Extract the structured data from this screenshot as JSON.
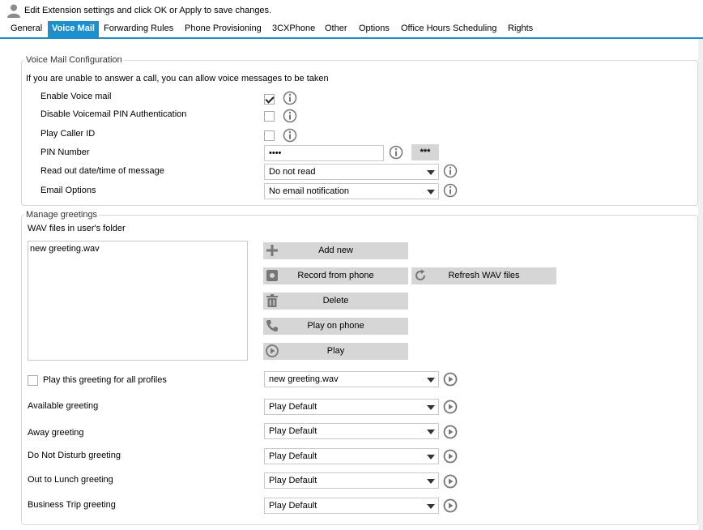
{
  "header": {
    "text": "Edit Extension settings and click OK or Apply to save changes."
  },
  "tabs": [
    {
      "label": "General"
    },
    {
      "label": "Voice Mail"
    },
    {
      "label": "Forwarding Rules"
    },
    {
      "label": "Phone Provisioning"
    },
    {
      "label": "3CXPhone"
    },
    {
      "label": "Other"
    },
    {
      "label": "Options"
    },
    {
      "label": "Office Hours Scheduling"
    },
    {
      "label": "Rights"
    }
  ],
  "active_tab": "Voice Mail",
  "voicemail": {
    "legend": "Voice Mail Configuration",
    "intro": "If you are unable to answer a call, you can allow voice messages to be taken",
    "enable_label": "Enable Voice mail",
    "enable_checked": true,
    "disable_pin_label": "Disable Voicemail PIN Authentication",
    "disable_pin_checked": false,
    "play_caller_label": "Play Caller ID",
    "play_caller_checked": false,
    "pin_label": "PIN Number",
    "pin_value": "••••",
    "pin_button": "***",
    "readout_label": "Read out date/time of message",
    "readout_value": "Do not read",
    "email_label": "Email Options",
    "email_value": "No email notification"
  },
  "greetings": {
    "legend": "Manage greetings",
    "wav_label": "WAV files in user's folder",
    "files": [
      "new greeting.wav"
    ],
    "add_new": "Add new",
    "record": "Record from phone",
    "refresh": "Refresh WAV files",
    "delete": "Delete",
    "play_on_phone": "Play on phone",
    "play": "Play",
    "all_profiles_label": "Play this greeting for all profiles",
    "all_profiles_checked": false,
    "all_profiles_value": "new greeting.wav",
    "profiles": [
      {
        "label": "Available greeting",
        "value": "Play Default"
      },
      {
        "label": "Away greeting",
        "value": "Play Default"
      },
      {
        "label": "Do Not Disturb greeting",
        "value": "Play Default"
      },
      {
        "label": "Out to Lunch greeting",
        "value": "Play Default"
      },
      {
        "label": "Business Trip greeting",
        "value": "Play Default"
      }
    ]
  },
  "colors": {
    "accent": "#1c8fcf",
    "button": "#d6d6d6",
    "icon": "#777777"
  }
}
